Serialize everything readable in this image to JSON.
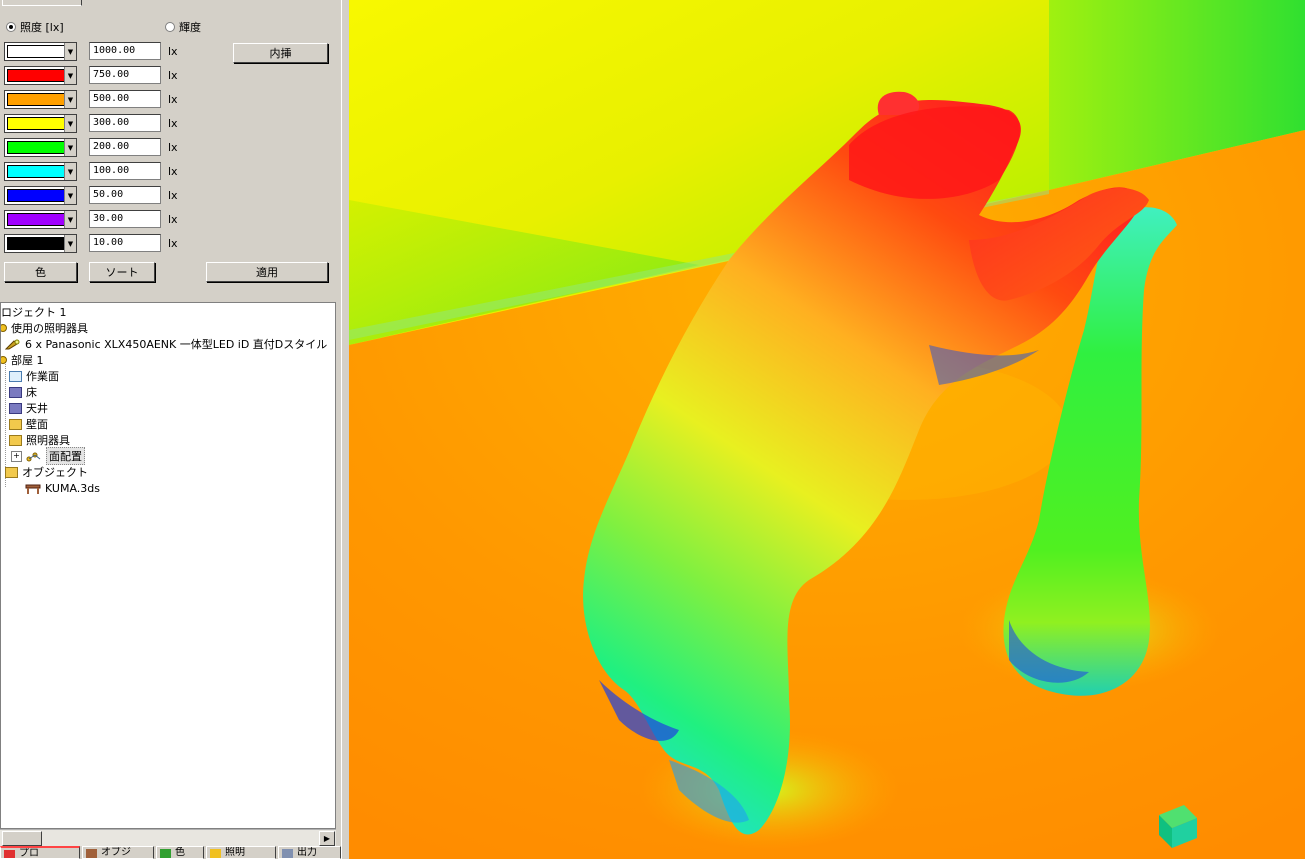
{
  "mode": {
    "illuminance_label": "照度 [lx]",
    "luminance_label": "輝度",
    "selected": "illuminance"
  },
  "legend": [
    {
      "color": "#ffffff",
      "value": "1000.00",
      "unit": "lx"
    },
    {
      "color": "#ff0000",
      "value": "750.00",
      "unit": "lx"
    },
    {
      "color": "#ffa000",
      "value": "500.00",
      "unit": "lx"
    },
    {
      "color": "#ffff00",
      "value": "300.00",
      "unit": "lx"
    },
    {
      "color": "#00ff00",
      "value": "200.00",
      "unit": "lx"
    },
    {
      "color": "#00ffff",
      "value": "100.00",
      "unit": "lx"
    },
    {
      "color": "#0000ff",
      "value": "50.00",
      "unit": "lx"
    },
    {
      "color": "#a000ff",
      "value": "30.00",
      "unit": "lx"
    },
    {
      "color": "#000000",
      "value": "10.00",
      "unit": "lx"
    }
  ],
  "buttons": {
    "interpolate": "内挿",
    "color": "色",
    "sort": "ソート",
    "apply": "適用"
  },
  "tree": {
    "project": "ロジェクト 1",
    "fixtures_used": "使用の照明器具",
    "fixture_entry": "6 x Panasonic XLX450AENK 一体型LED  iD  直付Dスタイル",
    "room": "部屋 1",
    "work_plane": "作業面",
    "floor": "床",
    "ceiling": "天井",
    "walls": "壁面",
    "luminaires": "照明器具",
    "area_arrangement": "面配置",
    "objects": "オブジェクト",
    "object_file": "KUMA.3ds"
  },
  "bottom_tabs": [
    "プロ",
    "オブジ",
    "色",
    "照明",
    "出力"
  ]
}
